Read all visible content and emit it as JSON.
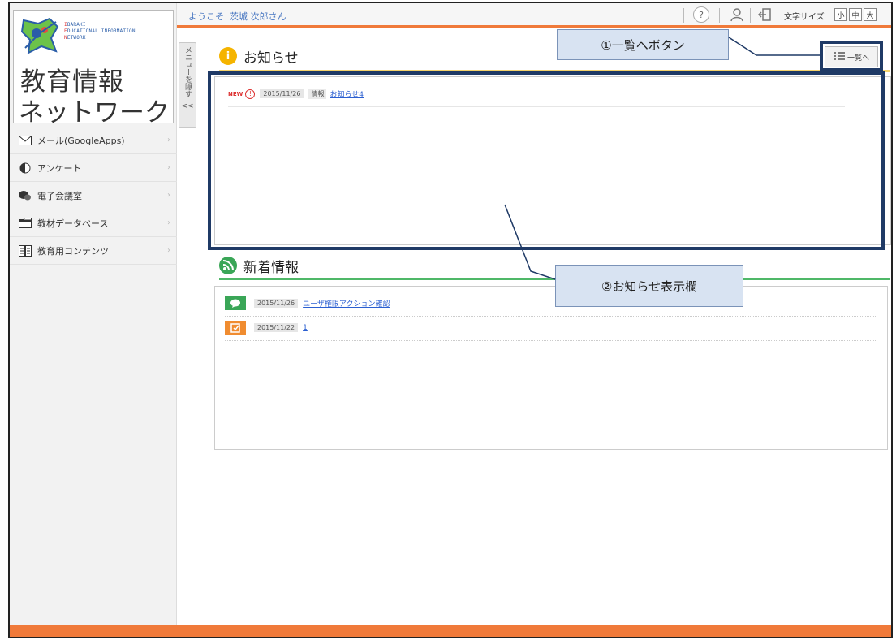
{
  "logo": {
    "en_lines": [
      {
        "cap": "I",
        "rest": "BARAKI"
      },
      {
        "cap": "E",
        "rest": "DUCATIONAL  I",
        "rest2": "NFORMATION"
      },
      {
        "cap": "N",
        "rest": "ETWORK"
      }
    ],
    "jp_line1": "教育情報",
    "jp_line2": "ネットワーク"
  },
  "menu_toggle": {
    "label": "メニューを隠す",
    "chevron": "<<"
  },
  "sidebar": {
    "items": [
      {
        "label": "メール(GoogleApps)",
        "icon": "mail-icon"
      },
      {
        "label": "アンケート",
        "icon": "survey-icon"
      },
      {
        "label": "電子会議室",
        "icon": "chat-icon"
      },
      {
        "label": "教材データベース",
        "icon": "folder-icon"
      },
      {
        "label": "教育用コンテンツ",
        "icon": "book-icon"
      }
    ]
  },
  "topbar": {
    "welcome": "ようこそ",
    "username": "茨城 次郎さん",
    "font_size_label": "文字サイズ",
    "font_sizes": [
      "小",
      "中",
      "大"
    ]
  },
  "notice": {
    "title": "お知らせ",
    "icon_char": "i",
    "list_button": "一覧へ",
    "items": [
      {
        "new": "NEW",
        "date": "2015/11/26",
        "category": "情報",
        "title": "お知らせ4"
      }
    ]
  },
  "news": {
    "title": "新着情報",
    "items": [
      {
        "date": "2015/11/26",
        "title": "ユーザ権限アクション確認",
        "icon": "chat-icon",
        "color": "#3aa657"
      },
      {
        "date": "2015/11/22",
        "title": "1",
        "icon": "survey-icon",
        "color": "#f08c30"
      }
    ]
  },
  "annotations": {
    "callout1": "①一覧へボタン",
    "callout2": "②お知らせ表示欄"
  },
  "colors": {
    "accent": "#f07a3a",
    "notice_yellow": "#f5b400",
    "news_green": "#3aa657",
    "callout_border": "#1f3a66"
  }
}
